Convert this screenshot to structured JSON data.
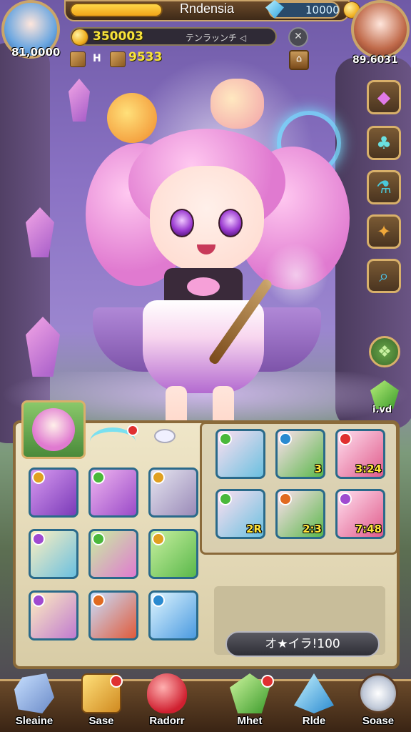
{
  "header": {
    "title": "Rndensia",
    "gems": "10000",
    "player_left_score": "81,0000",
    "player_right_score": "89.6031"
  },
  "resources": {
    "gold": "350003",
    "gold_label": "テンラッンチ ◁",
    "box_count_label": "H",
    "box_value": "9533"
  },
  "side_menu": {
    "items": [
      "gem-icon",
      "clover-icon",
      "potion-icon",
      "bread-icon",
      "magnifier-icon",
      "leaf-icon",
      "crystal-icon"
    ],
    "bottom_label": "i.vd"
  },
  "inventory": {
    "cards_right": [
      {
        "value": ""
      },
      {
        "value": "3"
      },
      {
        "value": "3:24"
      },
      {
        "value": "2R"
      },
      {
        "value": "2:3"
      },
      {
        "value": "7:48"
      }
    ],
    "buy_button": "オ★イラ!100"
  },
  "bottom_nav": [
    {
      "label": "Sleaine",
      "icon": "stone-icon"
    },
    {
      "label": "Sase",
      "icon": "treasure-icon",
      "badge": true
    },
    {
      "label": "Radorr",
      "icon": "heart-gem-icon"
    },
    {
      "label": "Mhet",
      "icon": "green-gem-icon",
      "badge": true
    },
    {
      "label": "Rlde",
      "icon": "blue-crystal-icon"
    },
    {
      "label": "Soase",
      "icon": "bone-icon"
    }
  ],
  "colors": {
    "accent_gold": "#caa56a",
    "panel": "#efe6c8",
    "xp_bar": "#f0a418",
    "dress_pink": "#e07ad0"
  }
}
